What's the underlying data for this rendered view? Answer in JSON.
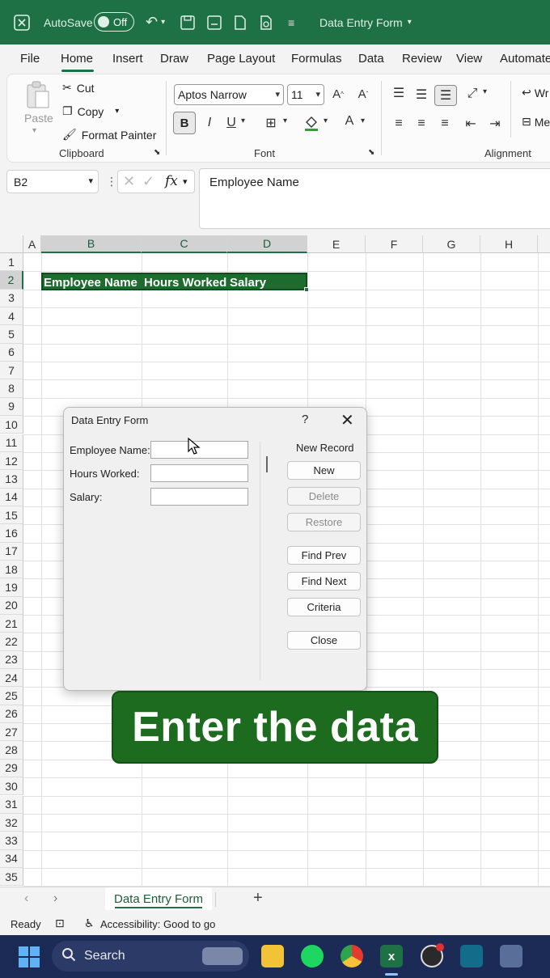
{
  "titlebar": {
    "autosave_label": "AutoSave",
    "autosave_state": "Off",
    "doc_title": "Data Entry Form"
  },
  "menu": [
    "File",
    "Home",
    "Insert",
    "Draw",
    "Page Layout",
    "Formulas",
    "Data",
    "Review",
    "View",
    "Automate"
  ],
  "ribbon": {
    "clipboard": {
      "paste": "Paste",
      "cut": "Cut",
      "copy": "Copy",
      "format_painter": "Format Painter",
      "label": "Clipboard"
    },
    "font": {
      "name": "Aptos Narrow",
      "size": "11",
      "bold": "B",
      "italic": "I",
      "underline": "U",
      "label": "Font"
    },
    "alignment": {
      "wrap": "Wr",
      "merge": "Me",
      "label": "Alignment"
    }
  },
  "formula_bar": {
    "cell_ref": "B2",
    "fx": "fx",
    "content": "Employee Name"
  },
  "sheet": {
    "columns": [
      "A",
      "B",
      "C",
      "D",
      "E",
      "F",
      "G",
      "H"
    ],
    "rows": [
      "1",
      "2",
      "3",
      "4",
      "5",
      "6",
      "7",
      "8",
      "9",
      "10",
      "11",
      "12",
      "13",
      "14",
      "15",
      "16",
      "17",
      "18",
      "19",
      "20",
      "21",
      "22",
      "23",
      "24",
      "25",
      "26",
      "27",
      "28",
      "29",
      "30",
      "31",
      "32",
      "33",
      "34",
      "35"
    ],
    "headers": {
      "b2": "Employee Name",
      "c2": "Hours Worked",
      "d2": "Salary"
    }
  },
  "dialog": {
    "title": "Data Entry Form",
    "help": "?",
    "close": "✕",
    "fields": [
      {
        "label": "Employee Name:",
        "value": ""
      },
      {
        "label": "Hours Worked:",
        "value": ""
      },
      {
        "label": "Salary:",
        "value": ""
      }
    ],
    "record_label": "New Record",
    "buttons": {
      "new": "New",
      "delete": "Delete",
      "restore": "Restore",
      "find_prev": "Find Prev",
      "find_next": "Find Next",
      "criteria": "Criteria",
      "close": "Close"
    }
  },
  "caption": "Enter the data",
  "sheet_tabs": {
    "active": "Data Entry Form",
    "add": "+"
  },
  "status": {
    "ready": "Ready",
    "accessibility": "Accessibility: Good to go"
  },
  "taskbar": {
    "search": "Search"
  }
}
